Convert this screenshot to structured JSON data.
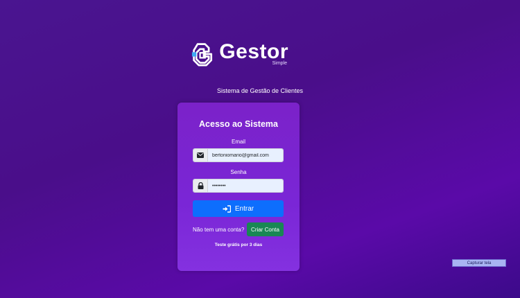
{
  "brand": {
    "name": "Gestor",
    "sub": "Simple",
    "tagline": "Sistema de Gestão de Clientes"
  },
  "login": {
    "title": "Acesso ao Sistema",
    "email_label": "Email",
    "email_value": "bertoniomario@gmail.com",
    "password_label": "Senha",
    "password_value": "••••••••",
    "submit_label": "Entrar",
    "signup_prompt": "Não tem uma conta?",
    "signup_button": "Criar Conta",
    "trial_text": "Teste grátis por 3 dias"
  },
  "overlay": {
    "capture_button": "Capturar tela"
  },
  "colors": {
    "primary_button": "#0d6efd",
    "success_button": "#198754",
    "card": "#7b22c9"
  },
  "icons": {
    "email": "envelope-icon",
    "password": "lock-icon",
    "submit": "sign-in-icon"
  }
}
